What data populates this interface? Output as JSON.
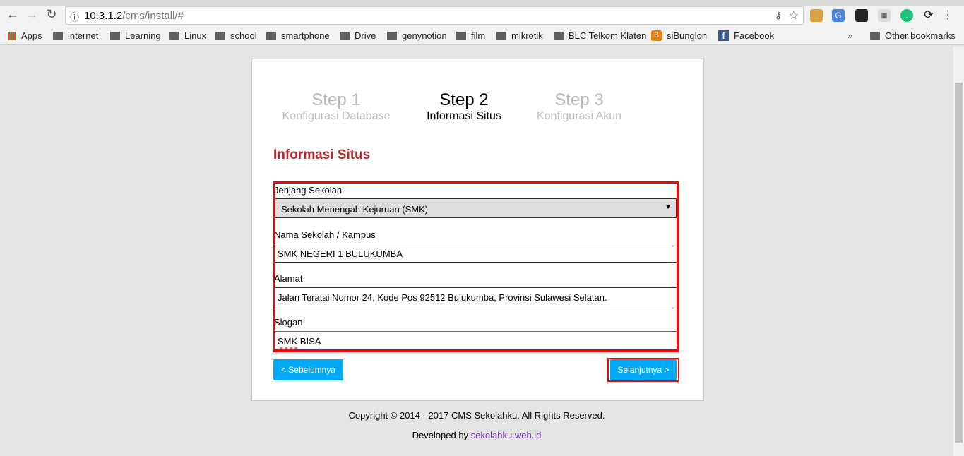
{
  "browser": {
    "url_host": "10.3.1.2",
    "url_path": "/cms/install/#",
    "bookmarks": [
      {
        "label": "Apps",
        "icon": "apps-grid-icon"
      },
      {
        "label": "internet",
        "icon": "folder-icon"
      },
      {
        "label": "Learning",
        "icon": "folder-icon"
      },
      {
        "label": "Linux",
        "icon": "folder-icon"
      },
      {
        "label": "school",
        "icon": "folder-icon"
      },
      {
        "label": "smartphone",
        "icon": "folder-icon"
      },
      {
        "label": "Drive",
        "icon": "folder-icon"
      },
      {
        "label": "genynotion",
        "icon": "folder-icon"
      },
      {
        "label": "film",
        "icon": "folder-icon"
      },
      {
        "label": "mikrotik",
        "icon": "folder-icon"
      },
      {
        "label": "BLC Telkom Klaten",
        "icon": "folder-icon"
      },
      {
        "label": "siBunglon",
        "icon": "blogger-icon"
      },
      {
        "label": "Facebook",
        "icon": "facebook-icon"
      }
    ],
    "overflow": "»",
    "other_bookmarks": "Other bookmarks"
  },
  "steps": [
    {
      "title": "Step 1",
      "subtitle": "Konfigurasi Database",
      "active": false
    },
    {
      "title": "Step 2",
      "subtitle": "Informasi Situs",
      "active": true
    },
    {
      "title": "Step 3",
      "subtitle": "Konfigurasi Akun",
      "active": false
    }
  ],
  "form": {
    "heading": "Informasi Situs",
    "jenjang_label": "Jenjang Sekolah",
    "jenjang_value": "Sekolah Menengah Kejuruan (SMK)",
    "nama_label": "Nama Sekolah / Kampus",
    "nama_value": "SMK NEGERI 1 BULUKUMBA",
    "alamat_label": "Alamat",
    "alamat_value": "Jalan Teratai Nomor 24, Kode Pos 92512 Bulukumba, Provinsi Sulawesi Selatan.",
    "slogan_label": "Slogan",
    "slogan_value_1": "SMK",
    "slogan_value_2": " BISA",
    "prev_button": "< Sebelumnya",
    "next_button": "Selanjutnya >"
  },
  "footer": {
    "copyright": "Copyright © 2014 - 2017 CMS Sekolahku. All Rights Reserved.",
    "developed_prefix": "Developed by ",
    "developed_link": "sekolahku.web.id"
  },
  "colors": {
    "accent": "#03a9f4",
    "heading": "#b7282e",
    "highlight": "#ff0000",
    "link": "#6b2fa8"
  }
}
